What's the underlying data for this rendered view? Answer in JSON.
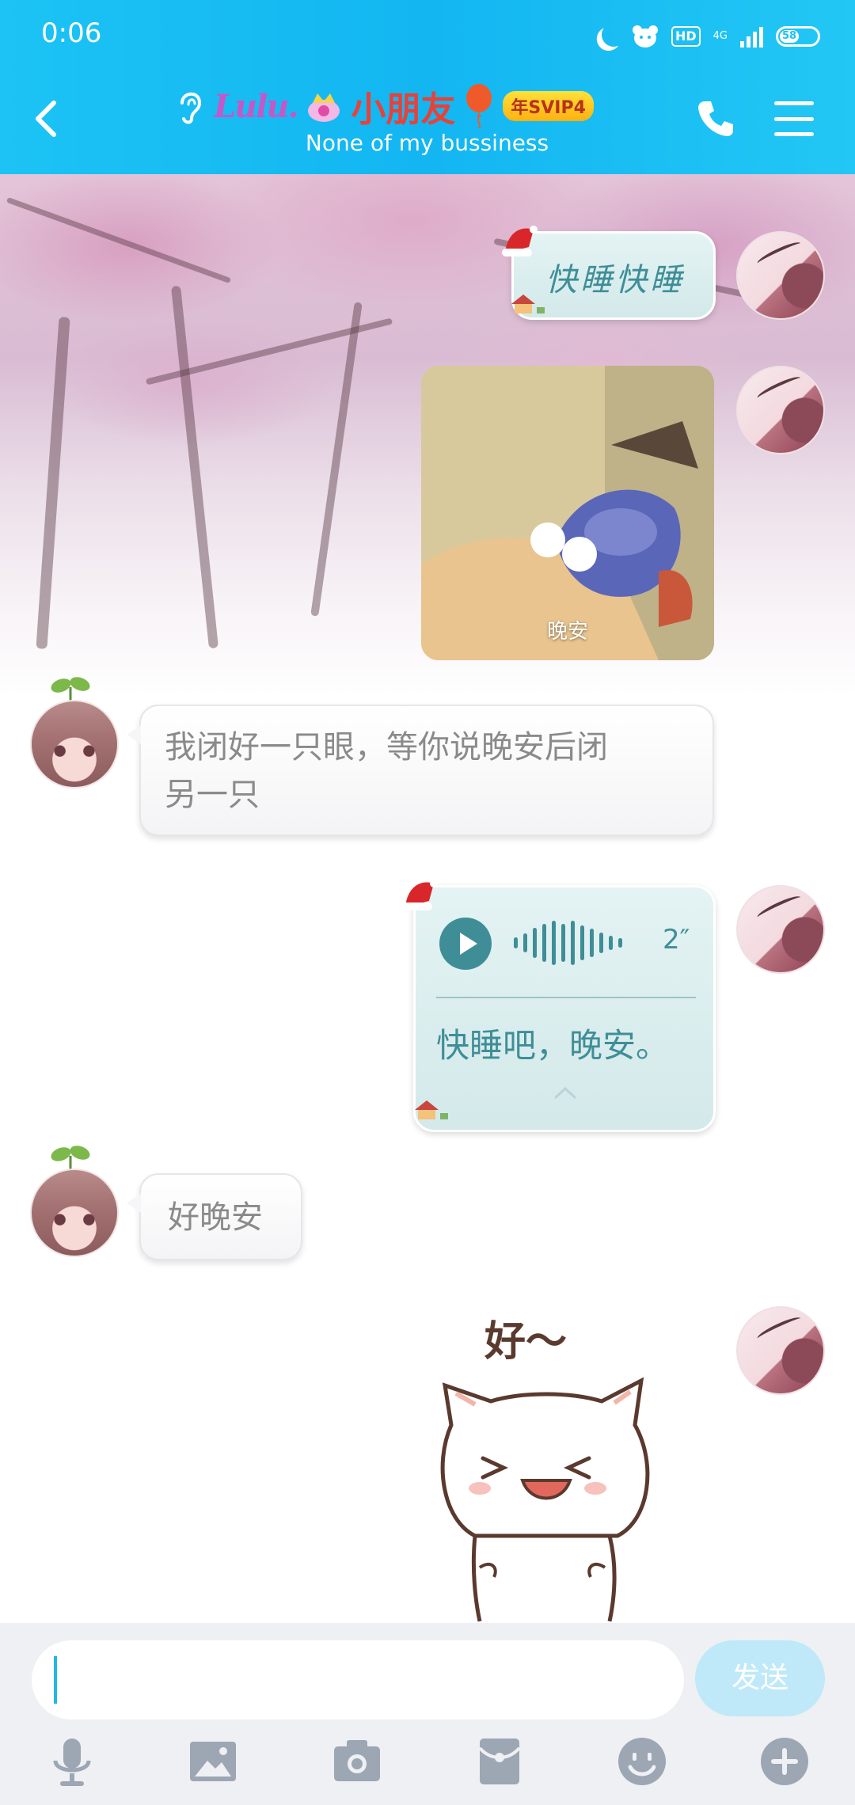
{
  "status_bar": {
    "time": "0:06",
    "hd_label": "HD",
    "network_label": "4G",
    "battery_level": "58"
  },
  "header": {
    "deco_name": "Lulu.",
    "name": "小朋友",
    "vip_badge": "年SVIP4",
    "subtitle": "None of my bussiness"
  },
  "messages": {
    "m1_text": "快睡快睡",
    "m2_image_caption": "晚安",
    "m3_line1": "我闭好一只眼，等你说晚安后闭",
    "m3_line2": "另一只",
    "m4_voice_duration": "2″",
    "m4_voice_transcript": "快睡吧，晚安。",
    "m5_text": "好晚安",
    "m6_sticker_text": "好～"
  },
  "input": {
    "value": "",
    "send_label": "发送"
  },
  "colors": {
    "header_blue": "#13b6f1",
    "self_bubble": "#d8ecec",
    "voice_accent": "#3f8e97",
    "send_disabled": "#bfe9f8"
  },
  "icons": [
    "back-icon",
    "ear-icon",
    "phone-icon",
    "menu-icon",
    "microphone-icon",
    "image-icon",
    "camera-icon",
    "red-packet-icon",
    "emoji-icon",
    "plus-icon"
  ]
}
